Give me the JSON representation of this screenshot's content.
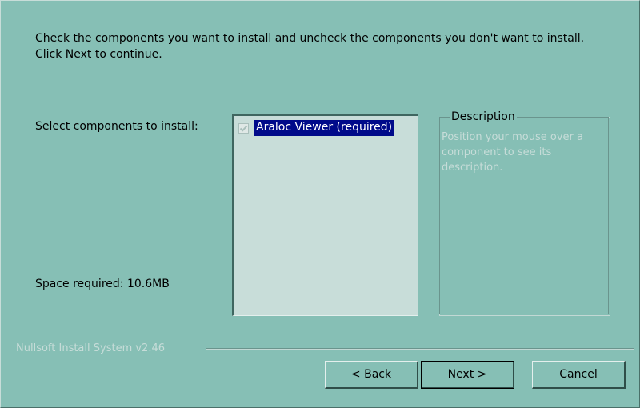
{
  "instructions": "Check the components you want to install and uncheck the components you don't want to install. Click Next to continue.",
  "select_label": "Select components to install:",
  "space_required": "Space required: 10.6MB",
  "components": [
    {
      "label": "Araloc Viewer (required)",
      "checked": true,
      "disabled": true,
      "selected": true
    }
  ],
  "description": {
    "title": "Description",
    "text": "Position your mouse over a component to see its description."
  },
  "branding": "Nullsoft Install System v2.46",
  "buttons": {
    "back": "< Back",
    "next": "Next >",
    "cancel": "Cancel"
  },
  "colors": {
    "background": "#86bfb5",
    "list_background": "#c8ddd9",
    "selection": "#000a8a",
    "disabled_text": "#c6dcd8"
  }
}
